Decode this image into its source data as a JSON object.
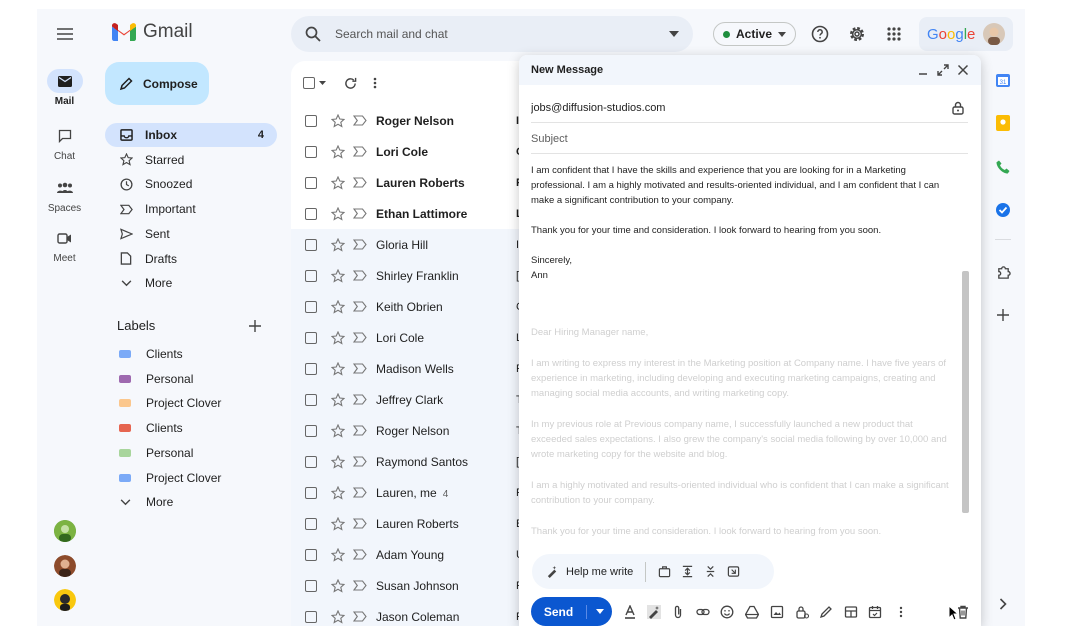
{
  "app": {
    "name": "Gmail",
    "brand_color": "#ea4335",
    "accent": "#0b57d0"
  },
  "rail": [
    {
      "label": "Mail",
      "icon": "mail-icon",
      "active": true
    },
    {
      "label": "Chat",
      "icon": "chat-icon",
      "active": false
    },
    {
      "label": "Spaces",
      "icon": "spaces-icon",
      "active": false
    },
    {
      "label": "Meet",
      "icon": "meet-icon",
      "active": false
    }
  ],
  "header": {
    "search_placeholder": "Search mail and chat",
    "status": "Active",
    "account": "Google"
  },
  "compose_button": "Compose",
  "nav": [
    {
      "label": "Inbox",
      "icon": "inbox-icon",
      "count": "4",
      "active": true
    },
    {
      "label": "Starred",
      "icon": "star-icon"
    },
    {
      "label": "Snoozed",
      "icon": "clock-icon"
    },
    {
      "label": "Important",
      "icon": "important-icon"
    },
    {
      "label": "Sent",
      "icon": "send-icon"
    },
    {
      "label": "Drafts",
      "icon": "draft-icon"
    },
    {
      "label": "More",
      "icon": "chevron-down-icon"
    }
  ],
  "labels": {
    "title": "Labels",
    "items": [
      {
        "name": "Clients",
        "color": "#7baaf7"
      },
      {
        "name": "Personal",
        "color": "#9e69af"
      },
      {
        "name": "Project Clover",
        "color": "#fbc78d"
      },
      {
        "name": "Clients",
        "color": "#e66550"
      },
      {
        "name": "Personal",
        "color": "#a8d59c"
      },
      {
        "name": "Project Clover",
        "color": "#7baaf7"
      }
    ],
    "more": "More"
  },
  "emails": [
    {
      "sender": "Roger Nelson",
      "unread": true,
      "initial": "I"
    },
    {
      "sender": "Lori Cole",
      "unread": true,
      "initial": "C"
    },
    {
      "sender": "Lauren Roberts",
      "unread": true,
      "initial": "F"
    },
    {
      "sender": "Ethan Lattimore",
      "unread": true,
      "initial": "L"
    },
    {
      "sender": "Gloria Hill",
      "unread": false,
      "initial": "I"
    },
    {
      "sender": "Shirley Franklin",
      "unread": false,
      "initial": "["
    },
    {
      "sender": "Keith Obrien",
      "unread": false,
      "initial": "C"
    },
    {
      "sender": "Lori Cole",
      "unread": false,
      "initial": "L"
    },
    {
      "sender": "Madison Wells",
      "unread": false,
      "initial": "F"
    },
    {
      "sender": "Jeffrey Clark",
      "unread": false,
      "initial": "T"
    },
    {
      "sender": "Roger Nelson",
      "unread": false,
      "initial": "T"
    },
    {
      "sender": "Raymond Santos",
      "unread": false,
      "initial": "["
    },
    {
      "sender": "Lauren, me",
      "count": "4",
      "unread": false,
      "initial": "F"
    },
    {
      "sender": "Lauren Roberts",
      "unread": false,
      "initial": "E"
    },
    {
      "sender": "Adam Young",
      "unread": false,
      "initial": "U"
    },
    {
      "sender": "Susan Johnson",
      "unread": false,
      "initial": "F"
    },
    {
      "sender": "Jason Coleman",
      "unread": false,
      "initial": "F"
    }
  ],
  "compose": {
    "title": "New Message",
    "to": "jobs@diffusion-studios.com",
    "subject_placeholder": "Subject",
    "body": [
      "I am confident that I have the skills and experience that you are looking for in a Marketing professional. I am a highly motivated and results-oriented individual, and I am confident that I can make a significant contribution to your company.",
      "Thank you for your time and consideration. I look forward to hearing from you soon.",
      "Sincerely,\nAnn"
    ],
    "ghost": [
      "Dear Hiring Manager name,",
      "I am writing to express my interest in the Marketing position at Company name. I have five years of experience in marketing, including developing and executing marketing campaigns, creating and managing social media accounts, and writing marketing copy.",
      "In my previous role at Previous company name, I successfully launched a new product that exceeded sales expectations. I also grew the company's social media following by over 10,000 and wrote marketing copy for the website and blog.",
      "I am a highly motivated and results-oriented individual who is confident that I can make a significant contribution to your company.",
      "Thank you for your time and consideration. I look forward to hearing from you soon."
    ],
    "help_me_write": "Help me write",
    "send": "Send"
  }
}
